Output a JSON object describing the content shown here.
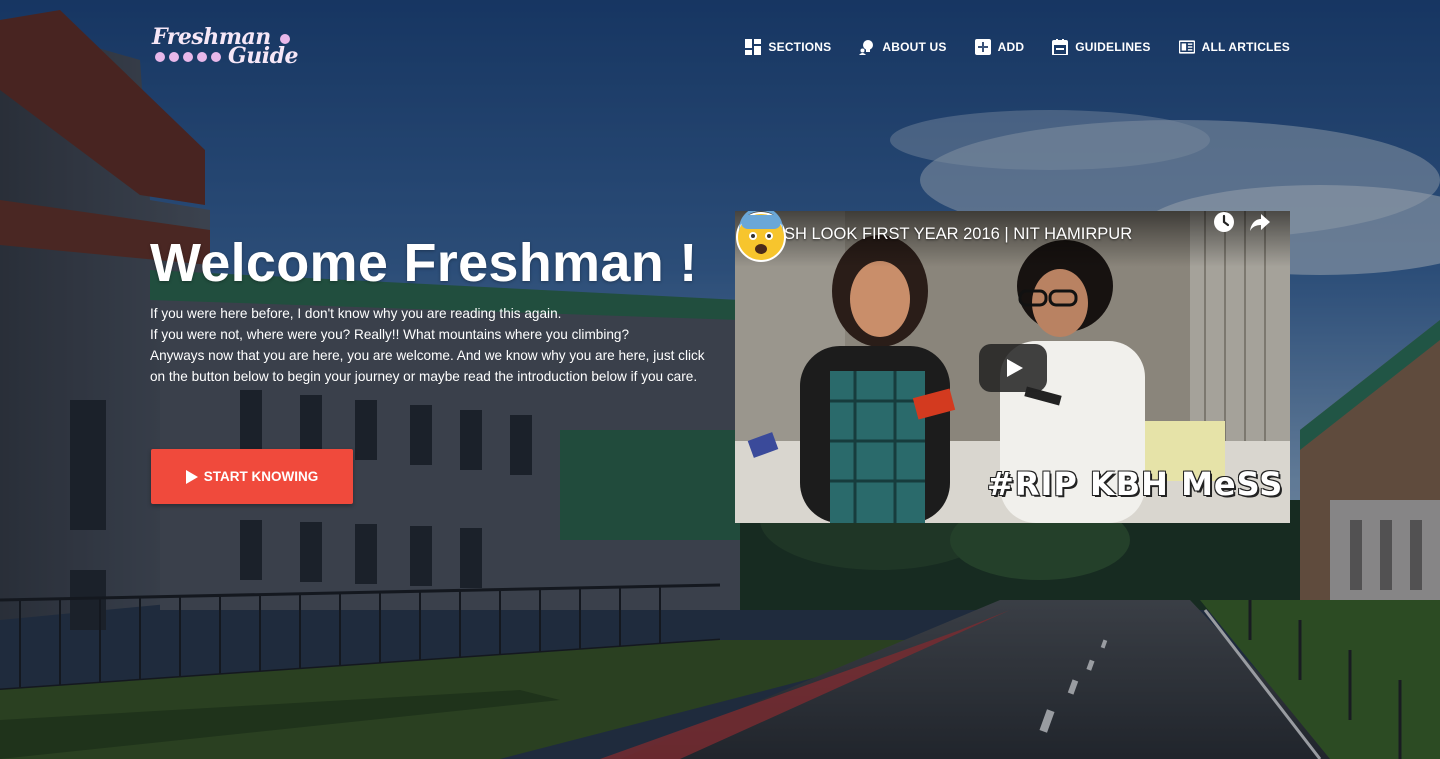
{
  "logo": {
    "line1": "Freshman",
    "line2": "Guide"
  },
  "nav": {
    "items": [
      {
        "label": "SECTIONS",
        "icon": "grid-dashboard-icon"
      },
      {
        "label": "ABOUT US",
        "icon": "person-lightbulb-icon"
      },
      {
        "label": "ADD",
        "icon": "plus-box-icon"
      },
      {
        "label": "GUIDELINES",
        "icon": "calendar-icon"
      },
      {
        "label": "ALL ARTICLES",
        "icon": "newspaper-icon"
      }
    ]
  },
  "hero": {
    "title": "Welcome Freshman !",
    "lines": [
      "If you were here before, I don't know why you are reading this again.",
      "If you were not, where were you? Really!! What mountains where you climbing?",
      "Anyways now that you are here, you are welcome. And we know why you are here, just click on the button below to begin your journey or maybe read the introduction below if you care."
    ],
    "button_label": "START KNOWING"
  },
  "video": {
    "title": "FRESH LOOK FIRST YEAR 2016 | NIT HAMIRPUR",
    "caption": "#RIP KBH MeSS",
    "controls": [
      "watch-later-clock-icon",
      "share-arrow-icon",
      "play-icon"
    ]
  },
  "colors": {
    "accent": "#f04a3c",
    "logo": "#f6e7f7",
    "logo_dots": "#e9b8ea"
  }
}
